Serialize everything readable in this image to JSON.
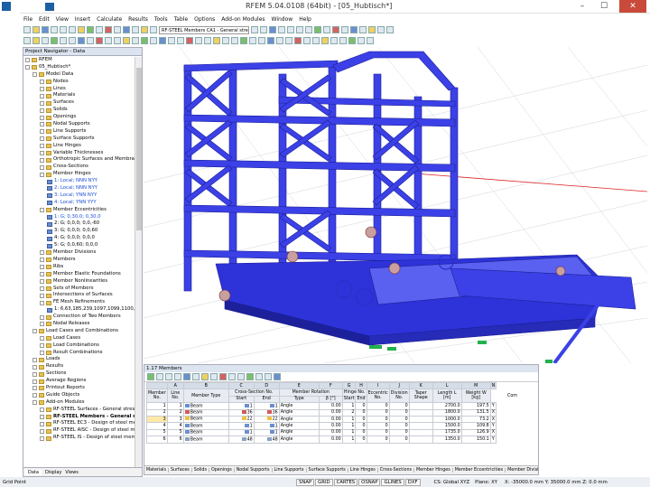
{
  "window": {
    "title": "RFEM 5.04.0108 (64bit) - [05_Hubtisch*]",
    "minimize": "–",
    "maximize": "☐",
    "close": "✕"
  },
  "menu": [
    "File",
    "Edit",
    "View",
    "Insert",
    "Calculate",
    "Results",
    "Tools",
    "Table",
    "Options",
    "Add-on Modules",
    "Window",
    "Help"
  ],
  "toolbar": {
    "module_combo": "RF-STEEL Members CA1 - General stres"
  },
  "navigator": {
    "title": "Project Navigator - Data",
    "tree": [
      {
        "label": "RFEM",
        "level": 0
      },
      {
        "label": "05_Hubtisch*",
        "level": 0
      },
      {
        "label": "Model Data",
        "level": 1
      },
      {
        "label": "Nodes",
        "level": 2
      },
      {
        "label": "Lines",
        "level": 2
      },
      {
        "label": "Materials",
        "level": 2
      },
      {
        "label": "Surfaces",
        "level": 2
      },
      {
        "label": "Solids",
        "level": 2
      },
      {
        "label": "Openings",
        "level": 2
      },
      {
        "label": "Nodal Supports",
        "level": 2
      },
      {
        "label": "Line Supports",
        "level": 2
      },
      {
        "label": "Surface Supports",
        "level": 2
      },
      {
        "label": "Line Hinges",
        "level": 2
      },
      {
        "label": "Variable Thicknesses",
        "level": 2
      },
      {
        "label": "Orthotropic Surfaces and Membra",
        "level": 2
      },
      {
        "label": "Cross-Sections",
        "level": 2
      },
      {
        "label": "Member Hinges",
        "level": 2
      },
      {
        "label": "1: Local; NNN NYY",
        "level": 3,
        "blue": true
      },
      {
        "label": "2: Local; NNN NYY",
        "level": 3,
        "blue": true
      },
      {
        "label": "3: Local; YNN NYY",
        "level": 3,
        "blue": true
      },
      {
        "label": "4: Local; YNN YYY",
        "level": 3,
        "blue": true
      },
      {
        "label": "Member Eccentricities",
        "level": 2
      },
      {
        "label": "1: G; 0,30,0; 0,30,0",
        "level": 3,
        "blue": true
      },
      {
        "label": "2: G; 0,0,0; 0,0,-60",
        "level": 3
      },
      {
        "label": "3: G; 0,0,0; 0,0,60",
        "level": 3
      },
      {
        "label": "4: G; 0,0,0; 0,0,0",
        "level": 3
      },
      {
        "label": "5: G; 0,0,60; 0,0,0",
        "level": 3
      },
      {
        "label": "Member Divisions",
        "level": 2
      },
      {
        "label": "Members",
        "level": 2
      },
      {
        "label": "Ribs",
        "level": 2
      },
      {
        "label": "Member Elastic Foundations",
        "level": 2
      },
      {
        "label": "Member Nonlinearities",
        "level": 2
      },
      {
        "label": "Sets of Members",
        "level": 2
      },
      {
        "label": "Intersections of Surfaces",
        "level": 2
      },
      {
        "label": "FE Mesh Refinements",
        "level": 2
      },
      {
        "label": "1: 6,63,185,239,1097,1099,1100,",
        "level": 3
      },
      {
        "label": "Connection of Two Members",
        "level": 2
      },
      {
        "label": "Nodal Releases",
        "level": 2
      },
      {
        "label": "Load Cases and Combinations",
        "level": 1
      },
      {
        "label": "Load Cases",
        "level": 2
      },
      {
        "label": "Load Combinations",
        "level": 2
      },
      {
        "label": "Result Combinations",
        "level": 2
      },
      {
        "label": "Loads",
        "level": 1
      },
      {
        "label": "Results",
        "level": 1
      },
      {
        "label": "Sections",
        "level": 1
      },
      {
        "label": "Average Regions",
        "level": 1
      },
      {
        "label": "Printout Reports",
        "level": 1
      },
      {
        "label": "Guide Objects",
        "level": 1
      },
      {
        "label": "Add-on Modules",
        "level": 1
      },
      {
        "label": "RF-STEEL Surfaces - General stress",
        "level": 2
      },
      {
        "label": "RF-STEEL Members - General stre",
        "level": 2,
        "bold": true
      },
      {
        "label": "RF-STEEL EC3 - Design of steel me",
        "level": 2
      },
      {
        "label": "RF-STEEL AISC - Design of steel m",
        "level": 2
      },
      {
        "label": "RF-STEEL IS - Design of steel mem",
        "level": 2
      }
    ],
    "tabs": [
      "Data",
      "Display",
      "Views"
    ]
  },
  "table": {
    "title": "1.17 Members",
    "letters": [
      "A",
      "B",
      "C",
      "D",
      "E",
      "F",
      "G",
      "H",
      "I",
      "J",
      "K",
      "L",
      "M",
      "N"
    ],
    "headers": {
      "member_no": "Member No.",
      "line_no": "Line No.",
      "member_type": "Member Type",
      "cs_group": "Cross-Section No.",
      "cs_start": "Start",
      "cs_end": "End",
      "rotation_group": "Member Rotation",
      "rot_type": "Type",
      "rot_beta": "β [°]",
      "hinge_group": "Hinge No.",
      "hinge_start": "Start",
      "hinge_end": "End",
      "eccentric": "Eccentric No.",
      "division": "Division No.",
      "taper": "Taper Shape",
      "length": "Length L [m]",
      "weight": "Weight W [kg]",
      "comment": "Com"
    },
    "rows": [
      {
        "no": "1",
        "line": "1",
        "type": "Beam",
        "cs_start": "1",
        "cs_end": "1",
        "rot_type": "Angle",
        "beta": "0.00",
        "h_start": "1",
        "h_end": "0",
        "ecc": "0",
        "div": "0",
        "length": "2700.0",
        "weight": "197.5",
        "flag": "Y"
      },
      {
        "no": "2",
        "line": "2",
        "type": "Beam",
        "cs_start": "36",
        "cs_end": "36",
        "rot_type": "Angle",
        "beta": "0.00",
        "h_start": "2",
        "h_end": "0",
        "ecc": "0",
        "div": "0",
        "length": "1800.0",
        "weight": "131.5",
        "flag": "X"
      },
      {
        "no": "3",
        "line": "3",
        "type": "Beam",
        "cs_start": "22",
        "cs_end": "22",
        "rot_type": "Angle",
        "beta": "0.00",
        "h_start": "1",
        "h_end": "0",
        "ecc": "0",
        "div": "0",
        "length": "1000.0",
        "weight": "73.2",
        "flag": "X"
      },
      {
        "no": "4",
        "line": "4",
        "type": "Beam",
        "cs_start": "1",
        "cs_end": "1",
        "rot_type": "Angle",
        "beta": "0.00",
        "h_start": "1",
        "h_end": "0",
        "ecc": "0",
        "div": "0",
        "length": "1500.0",
        "weight": "109.8",
        "flag": "Y"
      },
      {
        "no": "5",
        "line": "5",
        "type": "Beam",
        "cs_start": "1",
        "cs_end": "1",
        "rot_type": "Angle",
        "beta": "0.00",
        "h_start": "1",
        "h_end": "0",
        "ecc": "0",
        "div": "0",
        "length": "1735.0",
        "weight": "126.9",
        "flag": "X"
      },
      {
        "no": "6",
        "line": "6",
        "type": "Beam",
        "cs_start": "48",
        "cs_end": "48",
        "rot_type": "Angle",
        "beta": "0.00",
        "h_start": "1",
        "h_end": "0",
        "ecc": "0",
        "div": "0",
        "length": "1350.0",
        "weight": "150.1",
        "flag": "Y"
      }
    ],
    "tabs": [
      "Materials",
      "Surfaces",
      "Solids",
      "Openings",
      "Nodal Supports",
      "Line Supports",
      "Surface Supports",
      "Line Hinges",
      "Cross-Sections",
      "Member Hinges",
      "Member Eccentricities",
      "Member Divisions",
      "Memb"
    ]
  },
  "statusbar": {
    "left": "Grid Point",
    "buttons": [
      "SNAP",
      "GRID",
      "CARTES",
      "OSNAP",
      "GLINES",
      "DXF"
    ],
    "cs": "CS: Global XYZ",
    "plane": "Plane: XY",
    "coords": "X: -35000.0 mm Y: 35000.0 mm Z: 0.0 mm"
  },
  "colors": {
    "structure": "#3a40e8",
    "structure_dark": "#1c1f9c",
    "support": "#22b14c",
    "header": "#dbe4ef"
  }
}
